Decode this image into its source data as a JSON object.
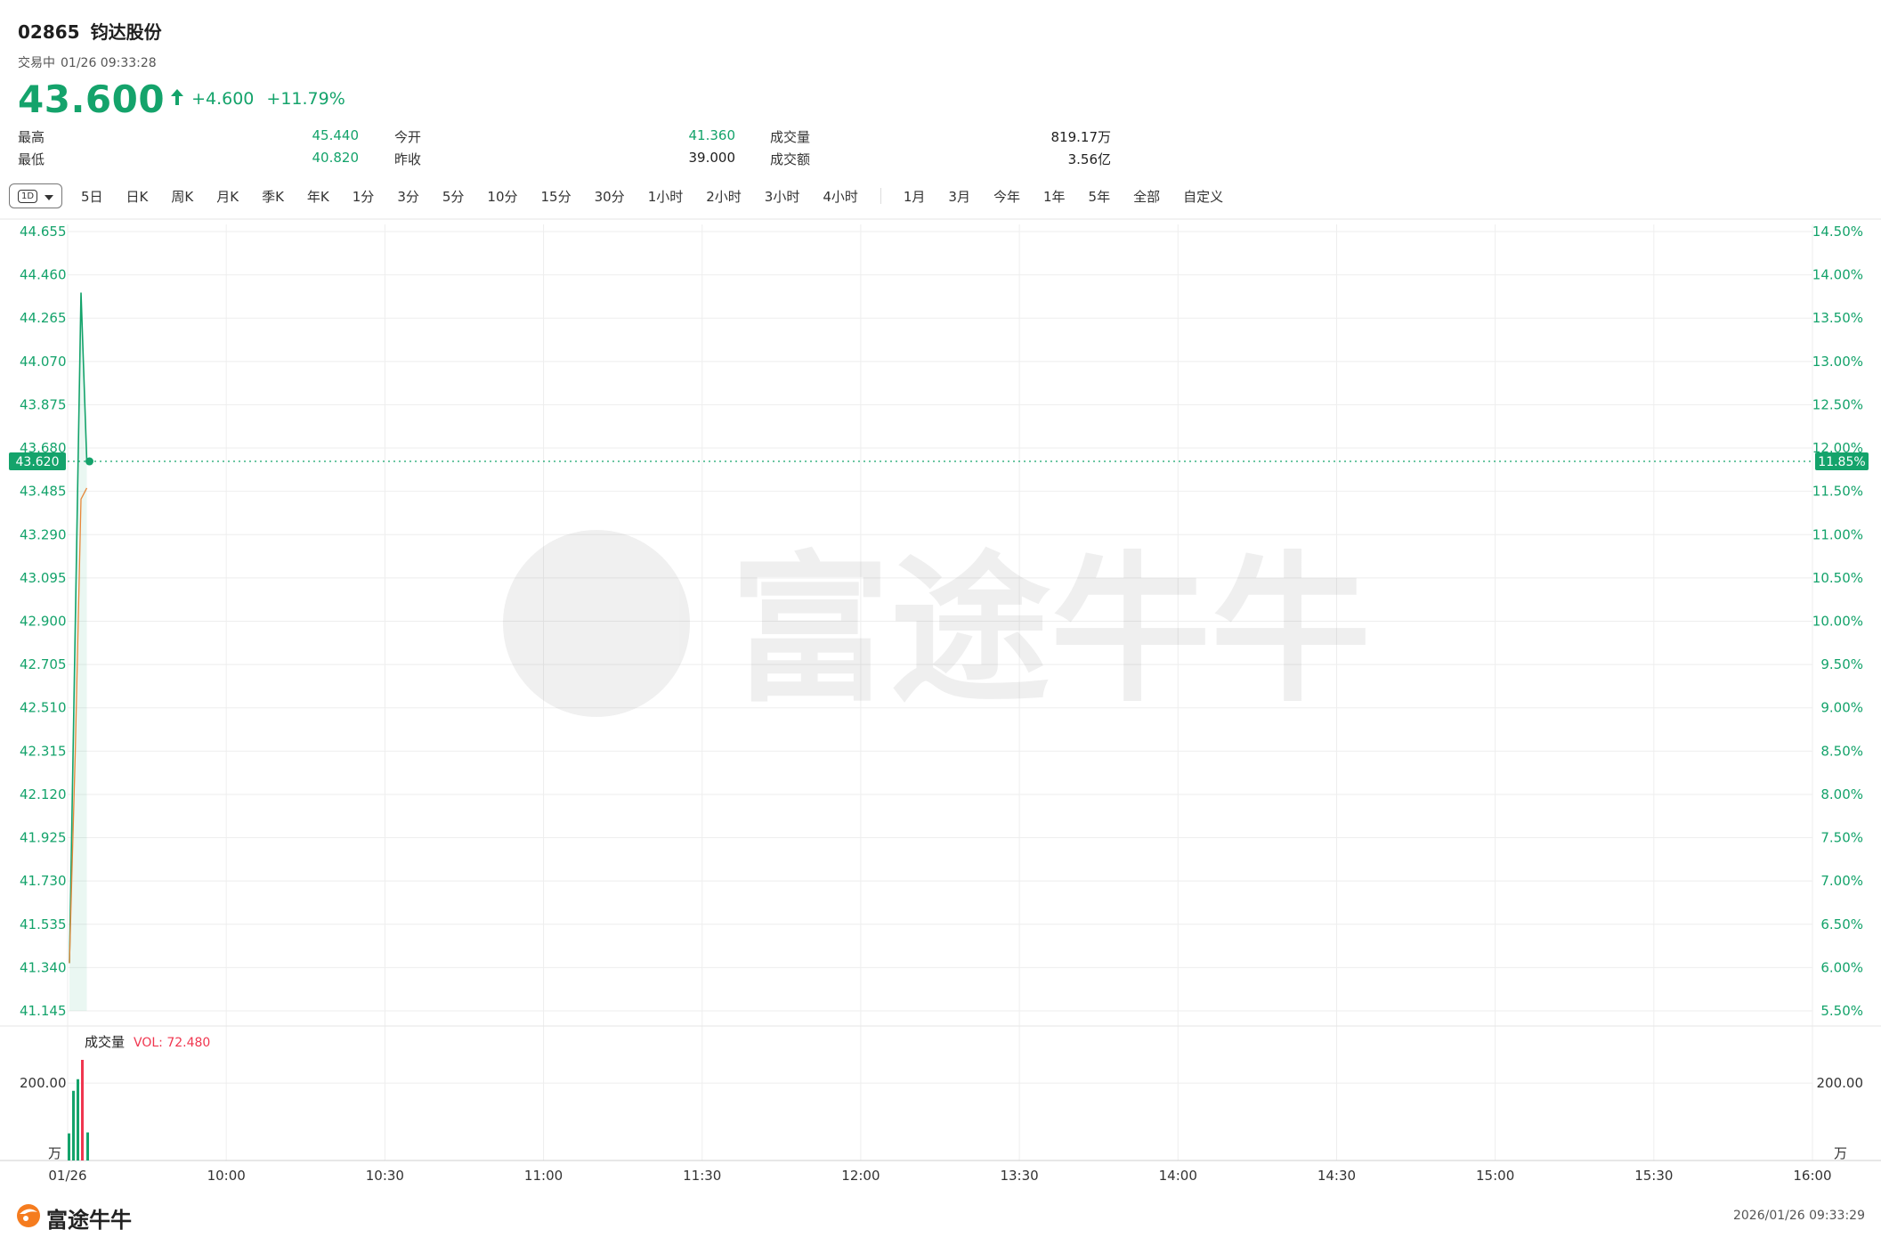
{
  "header": {
    "code": "02865",
    "name": "钧达股份",
    "status": "交易中",
    "datetime": "01/26 09:33:28",
    "last_price": "43.600",
    "change": "+4.600",
    "change_pct": "+11.79%"
  },
  "stats": {
    "high_label": "最高",
    "high": "45.440",
    "low_label": "最低",
    "low": "40.820",
    "open_label": "今开",
    "open": "41.360",
    "prev_close_label": "昨收",
    "prev_close": "39.000",
    "volume_label": "成交量",
    "volume": "819.17万",
    "turnover_label": "成交额",
    "turnover": "3.56亿"
  },
  "toolbar": {
    "period_chip": "1D",
    "periods_a": [
      "5日",
      "日K",
      "周K",
      "月K",
      "季K",
      "年K",
      "1分",
      "3分",
      "5分",
      "10分",
      "15分",
      "30分",
      "1小时",
      "2小时",
      "3小时",
      "4小时"
    ],
    "periods_b": [
      "1月",
      "3月",
      "今年",
      "1年",
      "5年",
      "全部",
      "自定义"
    ]
  },
  "colors": {
    "up": "#14a36b",
    "down": "#f0364f",
    "avg_line": "#e8883a",
    "grid": "#eeeeee"
  },
  "chart_data": {
    "type": "line",
    "x_ticks": [
      "01/26",
      "10:00",
      "10:30",
      "11:00",
      "11:30",
      "12:00",
      "13:30",
      "14:00",
      "14:30",
      "15:00",
      "15:30",
      "16:00"
    ],
    "y_left_ticks": [
      "44.655",
      "44.460",
      "44.265",
      "44.070",
      "43.875",
      "43.680",
      "43.485",
      "43.290",
      "43.095",
      "42.900",
      "42.705",
      "42.510",
      "42.315",
      "42.120",
      "41.925",
      "41.730",
      "41.535",
      "41.340",
      "41.145"
    ],
    "y_right_ticks": [
      "14.50%",
      "14.00%",
      "13.50%",
      "13.00%",
      "12.50%",
      "12.00%",
      "11.50%",
      "11.00%",
      "10.50%",
      "10.00%",
      "9.50%",
      "9.00%",
      "8.50%",
      "8.00%",
      "7.50%",
      "7.00%",
      "6.50%",
      "6.00%",
      "5.50%"
    ],
    "ylim": [
      41.145,
      44.655
    ],
    "prev_close": 39.0,
    "current": {
      "price_label": "43.620",
      "pct_label": "11.85%",
      "value": 43.62
    },
    "price_series": [
      {
        "t": "09:30",
        "v": 41.36
      },
      {
        "t": "09:31",
        "v": 42.87
      },
      {
        "t": "09:32",
        "v": 44.38
      },
      {
        "t": "09:33",
        "v": 43.62
      }
    ],
    "avg_series": [
      {
        "t": "09:30",
        "v": 41.36
      },
      {
        "t": "09:31",
        "v": 42.3
      },
      {
        "t": "09:32",
        "v": 43.45
      },
      {
        "t": "09:33",
        "v": 43.5
      }
    ],
    "volume": {
      "label": "成交量",
      "vol_text": "VOL: 72.480",
      "unit": "万",
      "tick": "200.00",
      "ylim": [
        0,
        260
      ],
      "bars": [
        {
          "t": "09:30",
          "v": 70,
          "dir": "up"
        },
        {
          "t": "09:31",
          "v": 180,
          "dir": "up"
        },
        {
          "t": "09:32",
          "v": 210,
          "dir": "up"
        },
        {
          "t": "09:33",
          "v": 260,
          "dir": "down"
        },
        {
          "t": "09:33b",
          "v": 72.48,
          "dir": "up"
        }
      ]
    }
  },
  "watermark": {
    "text": "富途牛牛"
  },
  "footer": {
    "logo_text": "富途牛牛",
    "timestamp": "2026/01/26 09:33:29"
  }
}
